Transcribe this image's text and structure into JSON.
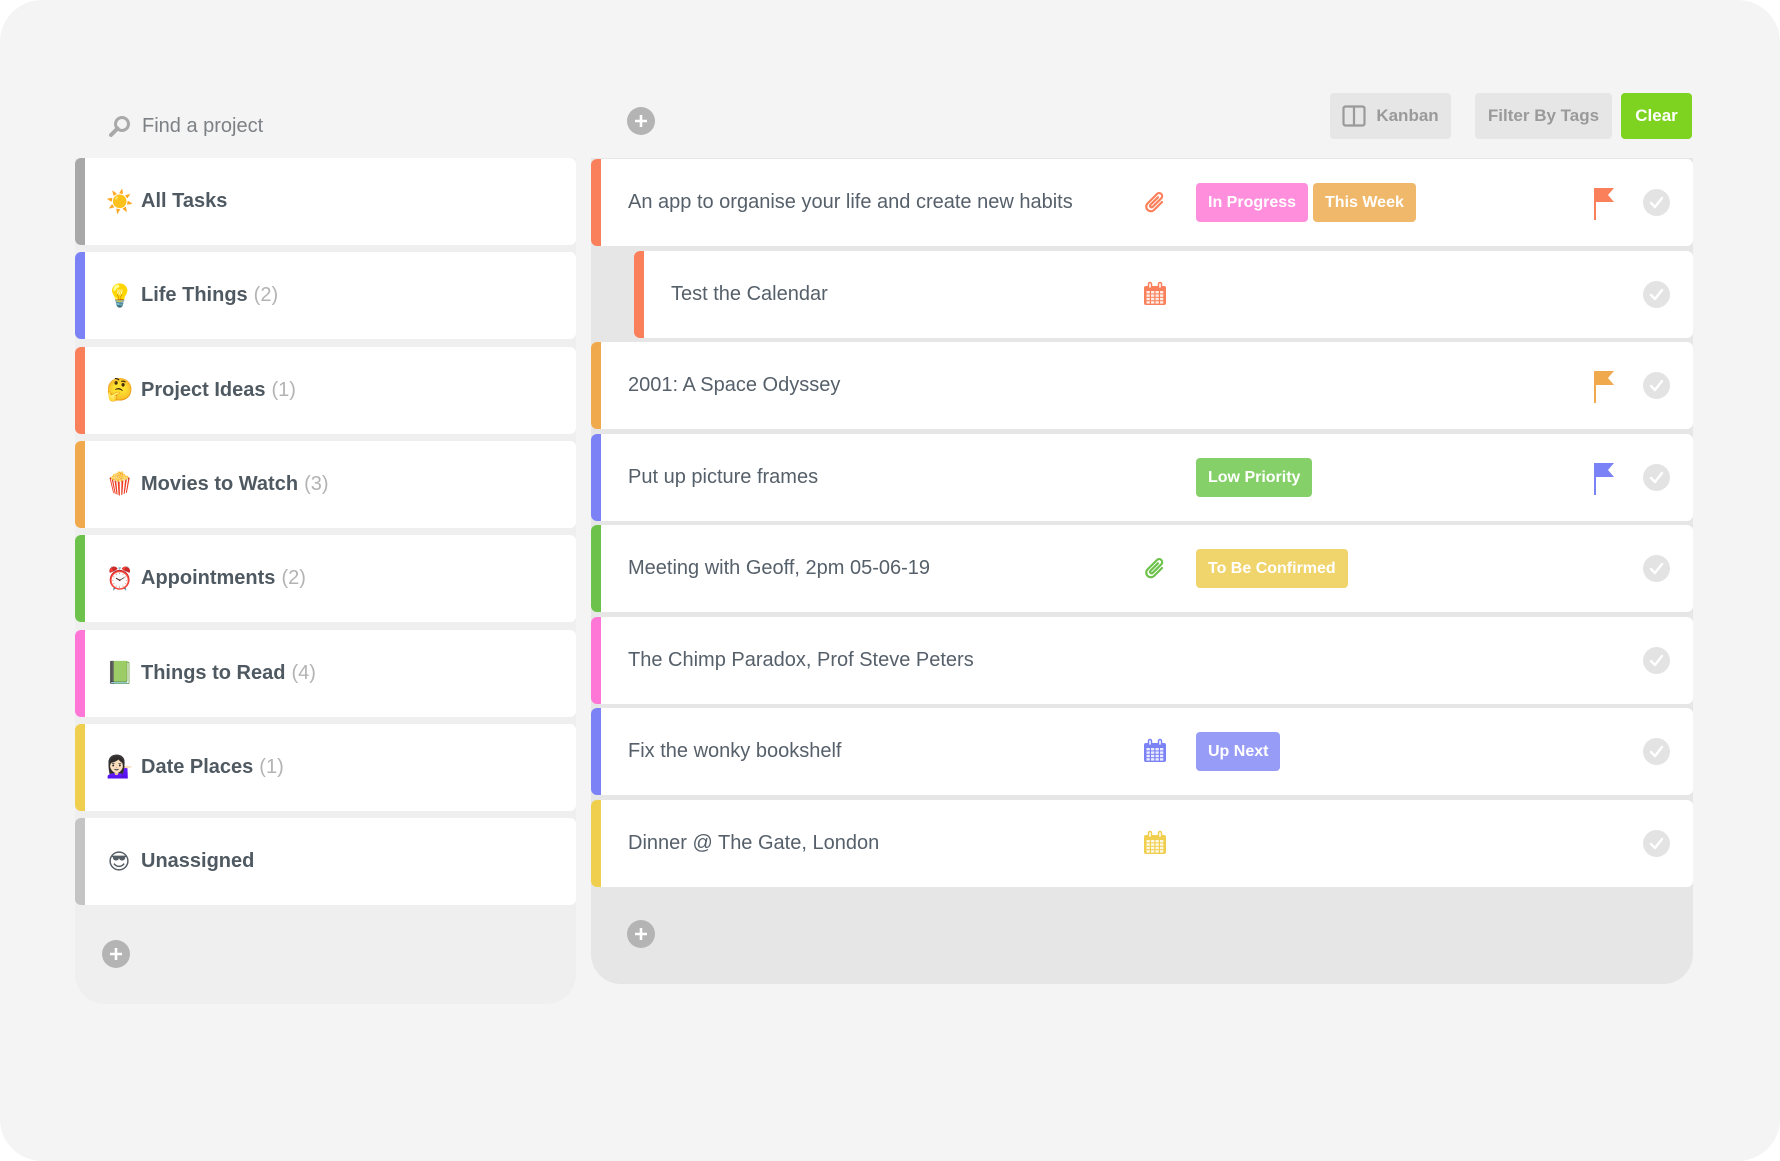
{
  "search": {
    "placeholder": "Find a project",
    "icon": "search-icon"
  },
  "toolbar": {
    "kanban_label": "Kanban",
    "filter_label": "Filter By Tags",
    "clear_label": "Clear",
    "clear_color": "#7ed321"
  },
  "projects": [
    {
      "emoji": "☀️",
      "name": "All Tasks",
      "count": "",
      "color": "#a8a8a8"
    },
    {
      "emoji": "💡",
      "name": "Life Things",
      "count": "(2)",
      "color": "#7b82f5"
    },
    {
      "emoji": "🤔",
      "name": "Project Ideas",
      "count": "(1)",
      "color": "#f9805a"
    },
    {
      "emoji": "🍿",
      "name": "Movies to Watch",
      "count": "(3)",
      "color": "#f0a94c"
    },
    {
      "emoji": "⏰",
      "name": "Appointments",
      "count": "(2)",
      "color": "#6cc24a"
    },
    {
      "emoji": "📗",
      "name": "Things to Read",
      "count": "(4)",
      "color": "#ff77d6"
    },
    {
      "emoji": "💁🏻‍♀️",
      "name": "Date Places",
      "count": "(1)",
      "color": "#f0cf4f"
    },
    {
      "emoji": "😎",
      "name": "Unassigned",
      "count": "",
      "color": "#c4c4c4"
    }
  ],
  "tasks": [
    {
      "title": "An app to organise your life and create new habits",
      "color": "#f9805a",
      "subtask": false,
      "icon": "paperclip",
      "icon_color": "#f9805a",
      "tags": [
        {
          "label": "In Progress",
          "color": "#ff8fdc"
        },
        {
          "label": "This Week",
          "color": "#f0b86a"
        }
      ],
      "flag_color": "#f9805a"
    },
    {
      "title": "Test the Calendar",
      "color": "#f9805a",
      "subtask": true,
      "icon": "calendar",
      "icon_color": "#f9805a",
      "tags": [],
      "flag_color": ""
    },
    {
      "title": "2001: A Space Odyssey",
      "color": "#f0a94c",
      "subtask": false,
      "icon": "",
      "icon_color": "",
      "tags": [],
      "flag_color": "#f0a94c"
    },
    {
      "title": "Put up picture frames",
      "color": "#7b82f5",
      "subtask": false,
      "icon": "",
      "icon_color": "",
      "tags": [
        {
          "label": "Low Priority",
          "color": "#86d06a"
        }
      ],
      "flag_color": "#7b82f5"
    },
    {
      "title": "Meeting with Geoff, 2pm 05-06-19",
      "color": "#6cc24a",
      "subtask": false,
      "icon": "paperclip",
      "icon_color": "#6cc24a",
      "tags": [
        {
          "label": "To Be Confirmed",
          "color": "#f0d46c"
        }
      ],
      "flag_color": ""
    },
    {
      "title": "The Chimp Paradox, Prof Steve Peters",
      "color": "#ff77d6",
      "subtask": false,
      "icon": "",
      "icon_color": "",
      "tags": [],
      "flag_color": ""
    },
    {
      "title": "Fix the wonky bookshelf",
      "color": "#7b82f5",
      "subtask": false,
      "icon": "calendar",
      "icon_color": "#7b82f5",
      "tags": [
        {
          "label": "Up Next",
          "color": "#979cf7"
        }
      ],
      "flag_color": ""
    },
    {
      "title": "Dinner @ The Gate, London",
      "color": "#f0cf4f",
      "subtask": false,
      "icon": "calendar",
      "icon_color": "#f0cf4f",
      "tags": [],
      "flag_color": ""
    }
  ]
}
